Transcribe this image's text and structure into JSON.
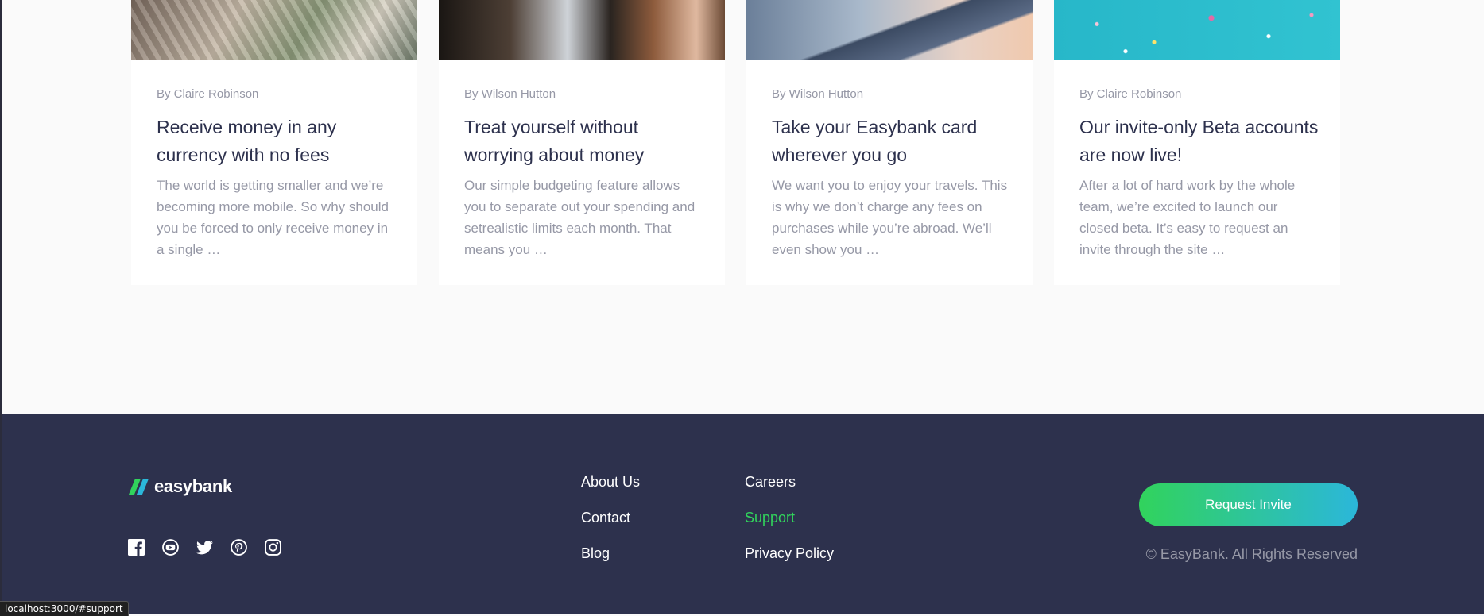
{
  "articles": [
    {
      "author": "By Claire Robinson",
      "title": "Receive money in any currency with no fees",
      "excerpt": "The world is getting smaller and we’re becoming more mobile. So why should you be forced to only receive money in a single …"
    },
    {
      "author": "By Wilson Hutton",
      "title": "Treat yourself without worrying about money",
      "excerpt": "Our simple budgeting feature allows you to separate out your spending and setrealistic limits each month. That means you …"
    },
    {
      "author": "By Wilson Hutton",
      "title": "Take your Easybank card wherever you go",
      "excerpt": "We want you to enjoy your travels. This is why we don’t charge any fees on purchases while you’re abroad. We’ll even show you …"
    },
    {
      "author": "By Claire Robinson",
      "title": "Our invite-only Beta accounts are now live!",
      "excerpt": "After a lot of hard work by the whole team, we’re excited to launch our closed beta. It’s easy to request an invite through the site …"
    }
  ],
  "footer": {
    "logo_text": "easybank",
    "socials": [
      "facebook-icon",
      "youtube-icon",
      "twitter-icon",
      "pinterest-icon",
      "instagram-icon"
    ],
    "links": {
      "about": "About Us",
      "contact": "Contact",
      "blog": "Blog",
      "careers": "Careers",
      "support": "Support",
      "privacy": "Privacy Policy"
    },
    "active_link": "Support",
    "cta_label": "Request Invite",
    "copyright": "© EasyBank. All Rights Reserved"
  },
  "status_bar_url": "localhost:3000/#support",
  "colors": {
    "footer_bg": "#2d314d",
    "accent_green": "#31d35c",
    "accent_cyan": "#2bb7da",
    "text_dark": "#2d314d",
    "text_muted": "#9698a6",
    "page_bg": "#fafafa"
  }
}
